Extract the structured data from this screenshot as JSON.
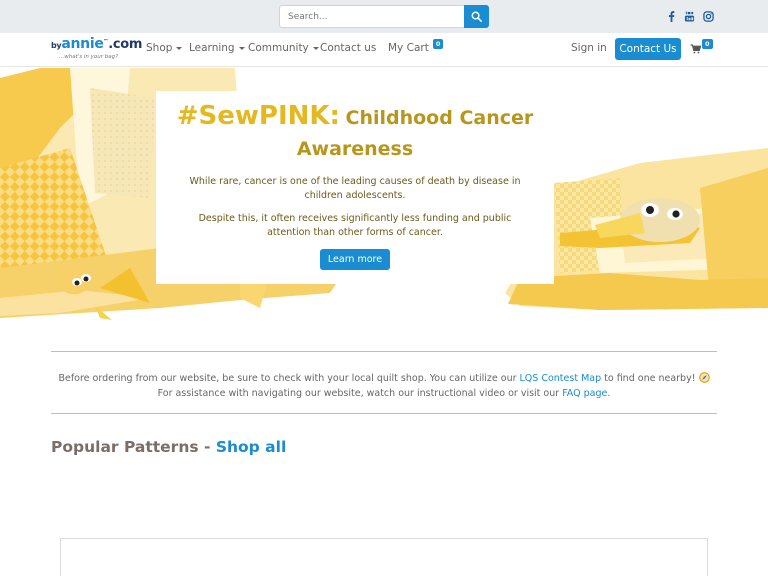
{
  "search": {
    "placeholder": "Search..."
  },
  "social": [
    "facebook-icon",
    "youtube-icon",
    "instagram-icon"
  ],
  "logo": {
    "by": "by",
    "annie": "annie",
    "com": ".com",
    "tm": "™",
    "tagline": "...what's in your bag?"
  },
  "nav": {
    "shop": "Shop",
    "learning": "Learning",
    "community": "Community",
    "contact": "Contact us",
    "cart": "My Cart",
    "cart_count": "0",
    "sign_in": "Sign in",
    "contact_btn": "Contact Us",
    "cart_icon_count": "0"
  },
  "hero": {
    "title_big": "#SewPINK:",
    "title_rest": "Childhood Cancer Awareness",
    "p1": "While rare, cancer is one of the leading causes of death by disease in children adolescents.",
    "p2": "Despite this, it often receives significantly less funding and public attention than other forms of cancer.",
    "button": "Learn more"
  },
  "info": {
    "line1_before": "Before ordering from our website, be sure to check with your local quilt shop. You can utilize our ",
    "line1_link": "LQS Contest Map",
    "line1_after": " to find one nearby!",
    "line2_before": "For assistance with navigating our website, watch our instructional video or visit our ",
    "line2_link": "FAQ page."
  },
  "popular": {
    "label": "Popular Patterns - ",
    "link": "Shop all"
  },
  "colors": {
    "accent": "#1a8cd1",
    "hero_title": "#e3b820",
    "hero_subtitle": "#b8961b"
  }
}
